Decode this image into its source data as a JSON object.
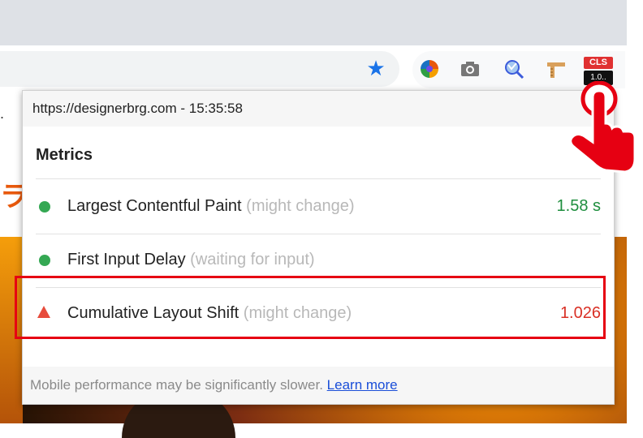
{
  "browser": {
    "extension_icons": [
      "color-wheel-icon",
      "camera-icon",
      "magnifier-icon",
      "ruler-icon"
    ],
    "cls_badge_label": "CLS",
    "cls_badge_value": "1.0..",
    "accent_color": "#1a73e8"
  },
  "page": {
    "left_snippet": ".",
    "orange_snippet": "ラ"
  },
  "popup": {
    "url_line": "https://designerbrg.com - 15:35:58",
    "section_title": "Metrics",
    "metrics": [
      {
        "name": "Largest Contentful Paint",
        "hint": "(might change)",
        "value": "1.58 s",
        "status": "good",
        "status_color": "#34a853"
      },
      {
        "name": "First Input Delay",
        "hint": "(waiting for input)",
        "value": "",
        "status": "good",
        "status_color": "#34a853"
      },
      {
        "name": "Cumulative Layout Shift",
        "hint": "(might change)",
        "value": "1.026",
        "status": "poor",
        "status_color": "#e74c3c"
      }
    ],
    "footer_text": "Mobile performance may be significantly slower.",
    "footer_link": "Learn more"
  },
  "annotation": {
    "highlight_color": "#e60012"
  }
}
